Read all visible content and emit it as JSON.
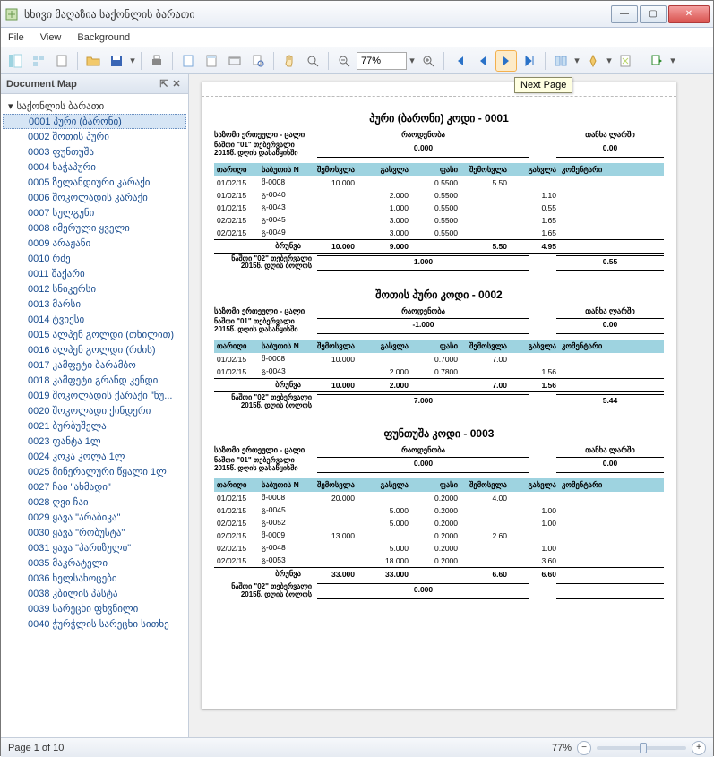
{
  "window": {
    "title": "სხივი მაღაზია საქონლის ბარათი"
  },
  "menu": {
    "file": "File",
    "view": "View",
    "background": "Background"
  },
  "toolbar": {
    "zoom_value": "77%"
  },
  "tooltip": {
    "next_page": "Next Page"
  },
  "docmap": {
    "title": "Document Map",
    "root": "საქონლის ბარათი",
    "items": [
      {
        "code": "0001",
        "name": "პური (ბარონი)"
      },
      {
        "code": "0002",
        "name": "შოთის პური"
      },
      {
        "code": "0003",
        "name": "ფუნთუშა"
      },
      {
        "code": "0004",
        "name": "ხაჭაპური"
      },
      {
        "code": "0005",
        "name": "ზელანდიური კარაქი"
      },
      {
        "code": "0006",
        "name": "შოკოლადის კარაქი"
      },
      {
        "code": "0007",
        "name": "სულგუნი"
      },
      {
        "code": "0008",
        "name": "იმერული ყველი"
      },
      {
        "code": "0009",
        "name": "არაჟანი"
      },
      {
        "code": "0010",
        "name": "რძე"
      },
      {
        "code": "0011",
        "name": "შაქარი"
      },
      {
        "code": "0012",
        "name": "სნიკერსი"
      },
      {
        "code": "0013",
        "name": "მარსი"
      },
      {
        "code": "0014",
        "name": "ტვიქსი"
      },
      {
        "code": "0015",
        "name": "ალპენ გოლდი (თხილით)"
      },
      {
        "code": "0016",
        "name": "ალპენ გოლდი (რძის)"
      },
      {
        "code": "0017",
        "name": "კამფეტი ბარამბო"
      },
      {
        "code": "0018",
        "name": "კამფეტი გრანდ კენდი"
      },
      {
        "code": "0019",
        "name": "შოკოლადის ქარაქი \"ნუ..."
      },
      {
        "code": "0020",
        "name": "შოკოლადი ქინდერი"
      },
      {
        "code": "0021",
        "name": "ბურბუშელა"
      },
      {
        "code": "0023",
        "name": "ფანტა 1ლ"
      },
      {
        "code": "0024",
        "name": "კოკა კოლა 1ლ"
      },
      {
        "code": "0025",
        "name": "მინერალური წყალი 1ლ"
      },
      {
        "code": "0027",
        "name": "ჩაი \"ახმადი\""
      },
      {
        "code": "0028",
        "name": "ღვი ჩაი"
      },
      {
        "code": "0029",
        "name": "ყავა \"არაბიკა\""
      },
      {
        "code": "0030",
        "name": "ყავა \"რობუსტა\""
      },
      {
        "code": "0031",
        "name": "ყავა \"პარიზული\""
      },
      {
        "code": "0035",
        "name": "მაკრატელი"
      },
      {
        "code": "0036",
        "name": "ხელსახოცები"
      },
      {
        "code": "0038",
        "name": "კბილის პასტა"
      },
      {
        "code": "0039",
        "name": "სარეცხი ფხვნილი"
      },
      {
        "code": "0040",
        "name": "ჭურჭლის სარეცხი სითხე"
      }
    ]
  },
  "report": {
    "unit_label": "საზომი ერთეული - ცალი",
    "qty_label": "რაოდენობა",
    "amt_label": "თანხა ლარში",
    "bal_start_label": "ნაშთი \"01\" თებერვალი 2015წ. დღის დასაწყისში",
    "bal_end_label": "ნაშთი \"02\" თებერვალი 2015წ. დღის ბოლოს",
    "sum_label": "ბრუნვა",
    "cols": {
      "date": "თარიღი",
      "doc": "საბუთის N",
      "in": "შემოსვლა",
      "out": "გასვლა",
      "price": "ფასი",
      "in_amt": "შემოსვლა",
      "out_amt": "გასვლა",
      "comment": "კომენტარი"
    },
    "sections": [
      {
        "title": "პური (ბარონი) კოდი - 0001",
        "bal_start_qty": "0.000",
        "bal_start_amt": "0.00",
        "rows": [
          {
            "date": "01/02/15",
            "doc": "შ-0008",
            "in": "10.000",
            "out": "",
            "price": "0.5500",
            "in_amt": "5.50",
            "out_amt": ""
          },
          {
            "date": "01/02/15",
            "doc": "გ-0040",
            "in": "",
            "out": "2.000",
            "price": "0.5500",
            "in_amt": "",
            "out_amt": "1.10"
          },
          {
            "date": "01/02/15",
            "doc": "გ-0043",
            "in": "",
            "out": "1.000",
            "price": "0.5500",
            "in_amt": "",
            "out_amt": "0.55"
          },
          {
            "date": "02/02/15",
            "doc": "გ-0045",
            "in": "",
            "out": "3.000",
            "price": "0.5500",
            "in_amt": "",
            "out_amt": "1.65"
          },
          {
            "date": "02/02/15",
            "doc": "გ-0049",
            "in": "",
            "out": "3.000",
            "price": "0.5500",
            "in_amt": "",
            "out_amt": "1.65"
          }
        ],
        "sum_in": "10.000",
        "sum_out": "9.000",
        "sum_in_amt": "5.50",
        "sum_out_amt": "4.95",
        "bal_end_qty": "1.000",
        "bal_end_amt": "0.55"
      },
      {
        "title": "შოთის პური კოდი - 0002",
        "bal_start_qty": "-1.000",
        "bal_start_amt": "0.00",
        "rows": [
          {
            "date": "01/02/15",
            "doc": "შ-0008",
            "in": "10.000",
            "out": "",
            "price": "0.7000",
            "in_amt": "7.00",
            "out_amt": ""
          },
          {
            "date": "01/02/15",
            "doc": "გ-0043",
            "in": "",
            "out": "2.000",
            "price": "0.7800",
            "in_amt": "",
            "out_amt": "1.56"
          }
        ],
        "sum_in": "10.000",
        "sum_out": "2.000",
        "sum_in_amt": "7.00",
        "sum_out_amt": "1.56",
        "bal_end_qty": "7.000",
        "bal_end_amt": "5.44"
      },
      {
        "title": "ფუნთუშა კოდი - 0003",
        "bal_start_qty": "0.000",
        "bal_start_amt": "0.00",
        "rows": [
          {
            "date": "01/02/15",
            "doc": "შ-0008",
            "in": "20.000",
            "out": "",
            "price": "0.2000",
            "in_amt": "4.00",
            "out_amt": ""
          },
          {
            "date": "01/02/15",
            "doc": "გ-0045",
            "in": "",
            "out": "5.000",
            "price": "0.2000",
            "in_amt": "",
            "out_amt": "1.00"
          },
          {
            "date": "02/02/15",
            "doc": "გ-0052",
            "in": "",
            "out": "5.000",
            "price": "0.2000",
            "in_amt": "",
            "out_amt": "1.00"
          },
          {
            "date": "02/02/15",
            "doc": "შ-0009",
            "in": "13.000",
            "out": "",
            "price": "0.2000",
            "in_amt": "2.60",
            "out_amt": ""
          },
          {
            "date": "02/02/15",
            "doc": "გ-0048",
            "in": "",
            "out": "5.000",
            "price": "0.2000",
            "in_amt": "",
            "out_amt": "1.00"
          },
          {
            "date": "02/02/15",
            "doc": "გ-0053",
            "in": "",
            "out": "18.000",
            "price": "0.2000",
            "in_amt": "",
            "out_amt": "3.60"
          }
        ],
        "sum_in": "33.000",
        "sum_out": "33.000",
        "sum_in_amt": "6.60",
        "sum_out_amt": "6.60",
        "bal_end_qty": "0.000",
        "bal_end_amt": ""
      }
    ]
  },
  "status": {
    "page": "Page 1 of 10",
    "zoom": "77%"
  }
}
